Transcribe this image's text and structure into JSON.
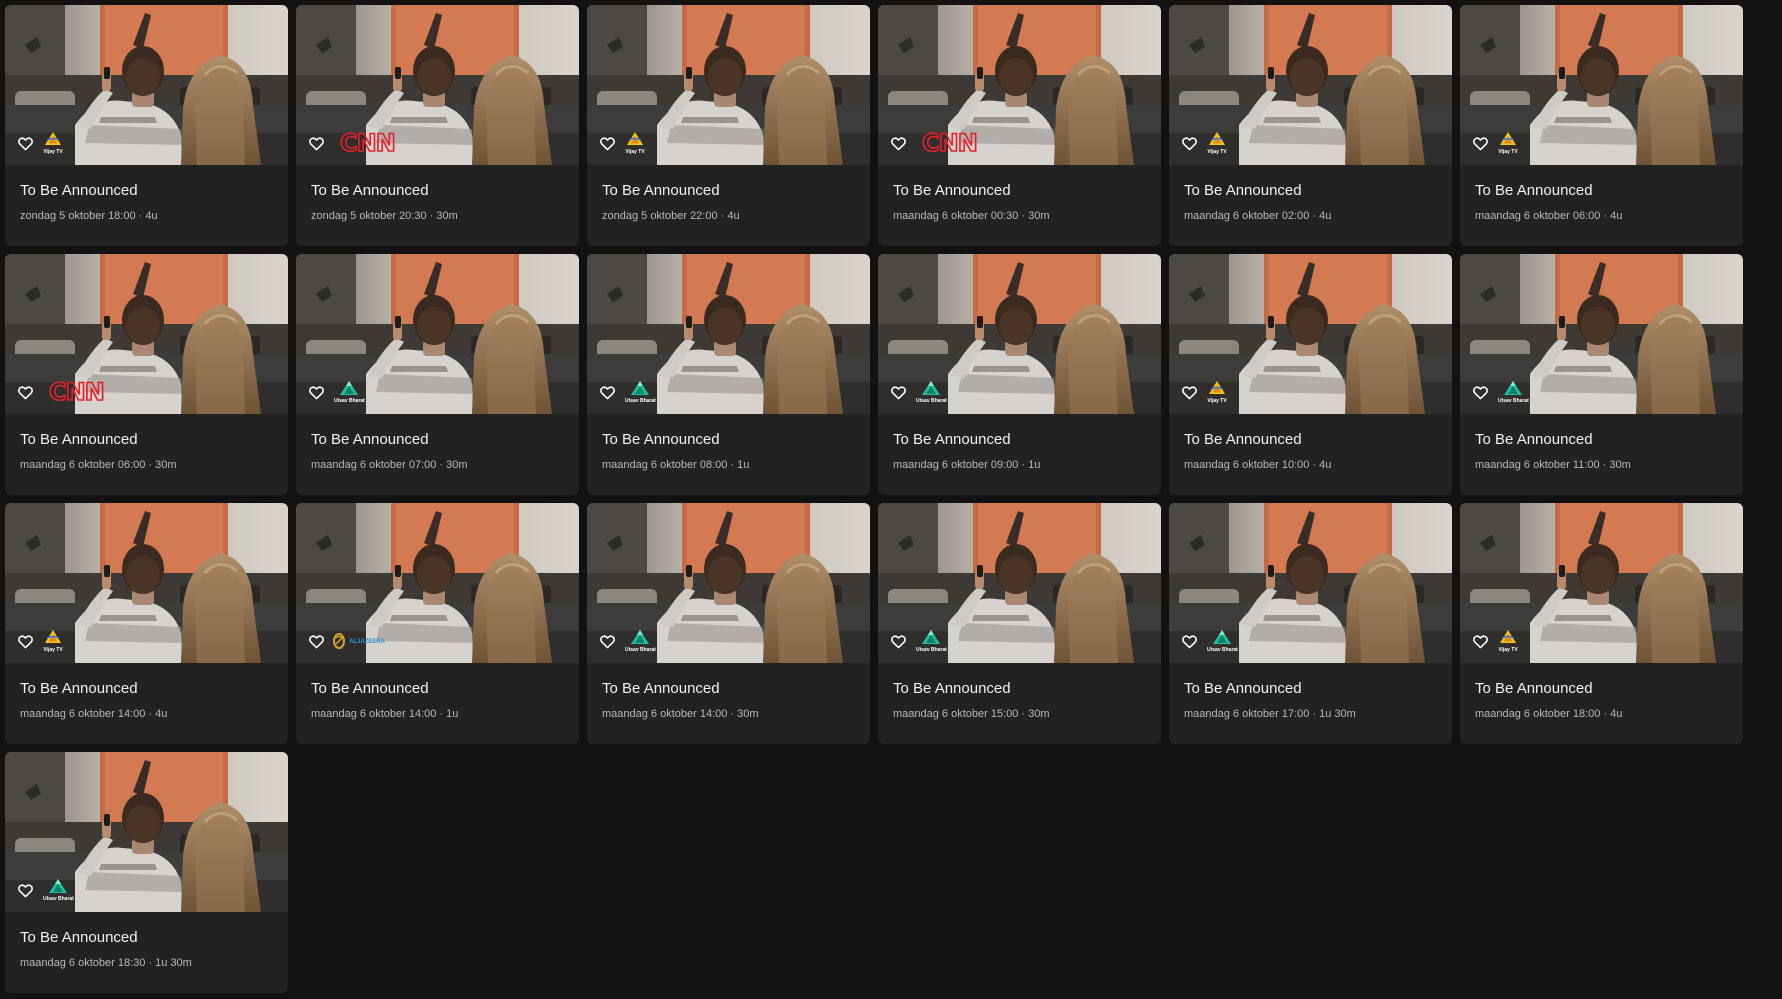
{
  "favorite_icon": "heart-outline-icon",
  "colors": {
    "background": "#121212",
    "card": "#222222",
    "cnn_red": "#e5202b",
    "vijay_yellow": "#f5c518",
    "utsav_teal": "#1fbf9c"
  },
  "channels": {
    "vijay": {
      "name": "Vijay TV",
      "logo": "vijay-tv-logo"
    },
    "cnn": {
      "name": "CNN",
      "logo": "cnn-logo"
    },
    "utsav": {
      "name": "Utsav Bharat",
      "logo": "utsav-bharat-logo"
    },
    "aljazeera": {
      "name": "ALJAZEERA",
      "logo": "aljazeera-logo"
    }
  },
  "programs": [
    {
      "title": "To Be Announced",
      "meta": "zondag 5 oktober 18:00 · 4u",
      "channel": "vijay"
    },
    {
      "title": "To Be Announced",
      "meta": "zondag 5 oktober 20:30 · 30m",
      "channel": "cnn"
    },
    {
      "title": "To Be Announced",
      "meta": "zondag 5 oktober 22:00 · 4u",
      "channel": "vijay"
    },
    {
      "title": "To Be Announced",
      "meta": "maandag 6 oktober 00:30 · 30m",
      "channel": "cnn"
    },
    {
      "title": "To Be Announced",
      "meta": "maandag 6 oktober 02:00 · 4u",
      "channel": "vijay"
    },
    {
      "title": "To Be Announced",
      "meta": "maandag 6 oktober 06:00 · 4u",
      "channel": "vijay"
    },
    {
      "title": "To Be Announced",
      "meta": "maandag 6 oktober 06:00 · 30m",
      "channel": "cnn"
    },
    {
      "title": "To Be Announced",
      "meta": "maandag 6 oktober 07:00 · 30m",
      "channel": "utsav"
    },
    {
      "title": "To Be Announced",
      "meta": "maandag 6 oktober 08:00 · 1u",
      "channel": "utsav"
    },
    {
      "title": "To Be Announced",
      "meta": "maandag 6 oktober 09:00 · 1u",
      "channel": "utsav"
    },
    {
      "title": "To Be Announced",
      "meta": "maandag 6 oktober 10:00 · 4u",
      "channel": "vijay"
    },
    {
      "title": "To Be Announced",
      "meta": "maandag 6 oktober 11:00 · 30m",
      "channel": "utsav"
    },
    {
      "title": "To Be Announced",
      "meta": "maandag 6 oktober 14:00 · 4u",
      "channel": "vijay"
    },
    {
      "title": "To Be Announced",
      "meta": "maandag 6 oktober 14:00 · 1u",
      "channel": "aljazeera"
    },
    {
      "title": "To Be Announced",
      "meta": "maandag 6 oktober 14:00 · 30m",
      "channel": "utsav"
    },
    {
      "title": "To Be Announced",
      "meta": "maandag 6 oktober 15:00 · 30m",
      "channel": "utsav"
    },
    {
      "title": "To Be Announced",
      "meta": "maandag 6 oktober 17:00 · 1u 30m",
      "channel": "utsav"
    },
    {
      "title": "To Be Announced",
      "meta": "maandag 6 oktober 18:00 · 4u",
      "channel": "vijay"
    },
    {
      "title": "To Be Announced",
      "meta": "maandag 6 oktober 18:30 · 1u 30m",
      "channel": "utsav"
    }
  ]
}
